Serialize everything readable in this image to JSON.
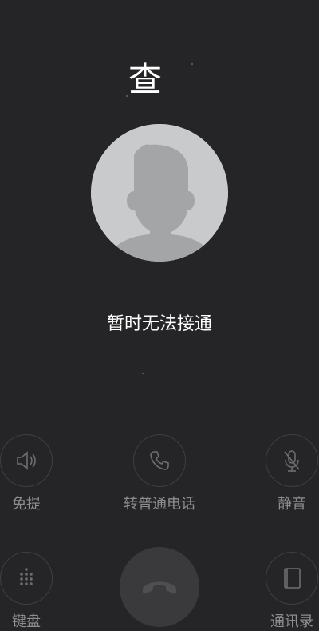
{
  "call": {
    "caller_name": "查",
    "status": "暂时无法接通"
  },
  "controls": {
    "speaker": {
      "label": "免提",
      "icon": "speaker-icon"
    },
    "transfer": {
      "label": "转普通电话",
      "icon": "phone-icon"
    },
    "mute": {
      "label": "静音",
      "icon": "microphone-muted-icon"
    },
    "keypad": {
      "label": "键盘",
      "icon": "keypad-icon"
    },
    "contacts": {
      "label": "通讯录",
      "icon": "contacts-book-icon"
    },
    "hangup": {
      "icon": "hang-up-icon"
    }
  },
  "colors": {
    "background": "#252527",
    "avatar_bg": "#c9cacb",
    "avatar_silhouette": "#a4a5a6",
    "control_label": "#8e8e91",
    "hangup_bg": "#3a3a3c"
  }
}
